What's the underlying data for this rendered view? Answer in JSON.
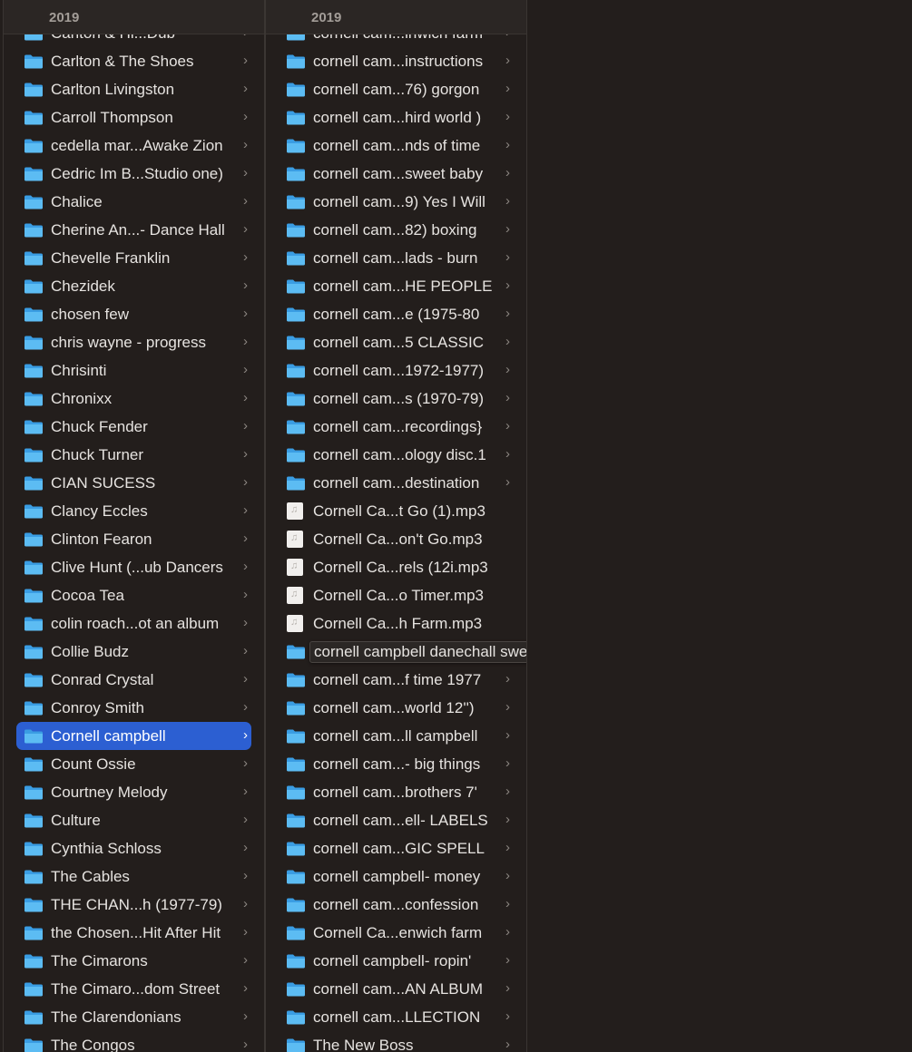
{
  "column1": {
    "header": "2019",
    "items": [
      {
        "label": "Carlton & Hi...Dub",
        "type": "folder"
      },
      {
        "label": "Carlton & The Shoes",
        "type": "folder"
      },
      {
        "label": "Carlton Livingston",
        "type": "folder"
      },
      {
        "label": "Carroll Thompson",
        "type": "folder"
      },
      {
        "label": "cedella mar...Awake Zion",
        "type": "folder"
      },
      {
        "label": "Cedric Im B...Studio one)",
        "type": "folder"
      },
      {
        "label": "Chalice",
        "type": "folder"
      },
      {
        "label": "Cherine An...- Dance Hall",
        "type": "folder"
      },
      {
        "label": "Chevelle Franklin",
        "type": "folder"
      },
      {
        "label": "Chezidek",
        "type": "folder"
      },
      {
        "label": "chosen few",
        "type": "folder"
      },
      {
        "label": "chris wayne - progress",
        "type": "folder"
      },
      {
        "label": "Chrisinti",
        "type": "folder"
      },
      {
        "label": "Chronixx",
        "type": "folder"
      },
      {
        "label": "Chuck Fender",
        "type": "folder"
      },
      {
        "label": "Chuck Turner",
        "type": "folder"
      },
      {
        "label": "CIAN SUCESS",
        "type": "folder"
      },
      {
        "label": "Clancy Eccles",
        "type": "folder"
      },
      {
        "label": "Clinton Fearon",
        "type": "folder"
      },
      {
        "label": "Clive Hunt (...ub Dancers",
        "type": "folder"
      },
      {
        "label": "Cocoa Tea",
        "type": "folder"
      },
      {
        "label": "colin roach...ot an album",
        "type": "folder"
      },
      {
        "label": "Collie Budz",
        "type": "folder"
      },
      {
        "label": "Conrad Crystal",
        "type": "folder"
      },
      {
        "label": "Conroy Smith",
        "type": "folder"
      },
      {
        "label": "Cornell campbell",
        "type": "folder",
        "selected": true
      },
      {
        "label": "Count Ossie",
        "type": "folder"
      },
      {
        "label": "Courtney Melody",
        "type": "folder"
      },
      {
        "label": "Culture",
        "type": "folder"
      },
      {
        "label": "Cynthia Schloss",
        "type": "folder"
      },
      {
        "label": "The Cables",
        "type": "folder"
      },
      {
        "label": "THE CHAN...h (1977-79)",
        "type": "folder"
      },
      {
        "label": "the Chosen...Hit After Hit",
        "type": "folder"
      },
      {
        "label": "The Cimarons",
        "type": "folder"
      },
      {
        "label": "The Cimaro...dom Street",
        "type": "folder"
      },
      {
        "label": "The Clarendonians",
        "type": "folder"
      },
      {
        "label": "The Congos",
        "type": "folder"
      }
    ]
  },
  "column2": {
    "header": "2019",
    "items": [
      {
        "label": "cornell cam...inwich farm",
        "type": "folder"
      },
      {
        "label": "cornell cam...instructions",
        "type": "folder"
      },
      {
        "label": "cornell cam...76) gorgon",
        "type": "folder"
      },
      {
        "label": "cornell cam...hird world )",
        "type": "folder"
      },
      {
        "label": "cornell cam...nds of time",
        "type": "folder"
      },
      {
        "label": "cornell cam...sweet baby",
        "type": "folder"
      },
      {
        "label": "cornell cam...9) Yes I Will",
        "type": "folder"
      },
      {
        "label": "cornell cam...82) boxing",
        "type": "folder"
      },
      {
        "label": "cornell cam...lads - burn",
        "type": "folder"
      },
      {
        "label": "cornell cam...HE PEOPLE",
        "type": "folder"
      },
      {
        "label": "cornell cam...e (1975-80",
        "type": "folder"
      },
      {
        "label": "cornell cam...5 CLASSIC",
        "type": "folder"
      },
      {
        "label": "cornell cam...1972-1977)",
        "type": "folder"
      },
      {
        "label": "cornell cam...s (1970-79)",
        "type": "folder"
      },
      {
        "label": "cornell cam...recordings}",
        "type": "folder"
      },
      {
        "label": "cornell cam...ology disc.1",
        "type": "folder"
      },
      {
        "label": "cornell cam...destination",
        "type": "folder"
      },
      {
        "label": "Cornell Ca...t Go (1).mp3",
        "type": "file"
      },
      {
        "label": "Cornell Ca...on't Go.mp3",
        "type": "file"
      },
      {
        "label": "Cornell Ca...rels (12i.mp3",
        "type": "file"
      },
      {
        "label": "Cornell Ca...o Timer.mp3",
        "type": "file"
      },
      {
        "label": "Cornell Ca...h Farm.mp3",
        "type": "file"
      },
      {
        "label": "cornell campbell danechall sweet",
        "type": "folder",
        "tooltip": true
      },
      {
        "label": "cornell cam...f time 1977",
        "type": "folder"
      },
      {
        "label": "cornell cam...world 12'')",
        "type": "folder"
      },
      {
        "label": "cornell cam...ll campbell",
        "type": "folder"
      },
      {
        "label": "cornell cam...- big things",
        "type": "folder"
      },
      {
        "label": "cornell cam...brothers 7'",
        "type": "folder"
      },
      {
        "label": "cornell cam...ell- LABELS",
        "type": "folder"
      },
      {
        "label": "cornell cam...GIC SPELL",
        "type": "folder"
      },
      {
        "label": "cornell campbell- money",
        "type": "folder"
      },
      {
        "label": "cornell cam...confession",
        "type": "folder"
      },
      {
        "label": "Cornell Ca...enwich farm",
        "type": "folder"
      },
      {
        "label": "cornell campbell- ropin'",
        "type": "folder"
      },
      {
        "label": "cornell cam...AN ALBUM",
        "type": "folder"
      },
      {
        "label": "cornell cam...LLECTION",
        "type": "folder"
      },
      {
        "label": "The New Boss",
        "type": "folder"
      }
    ]
  },
  "icons": {
    "folder": "folder-icon",
    "file": "audio-file-icon",
    "chevron": "chevron-right-icon"
  },
  "colors": {
    "background": "#231e1c",
    "selection": "#2c5fd2",
    "folder": "#4ab0ee"
  }
}
